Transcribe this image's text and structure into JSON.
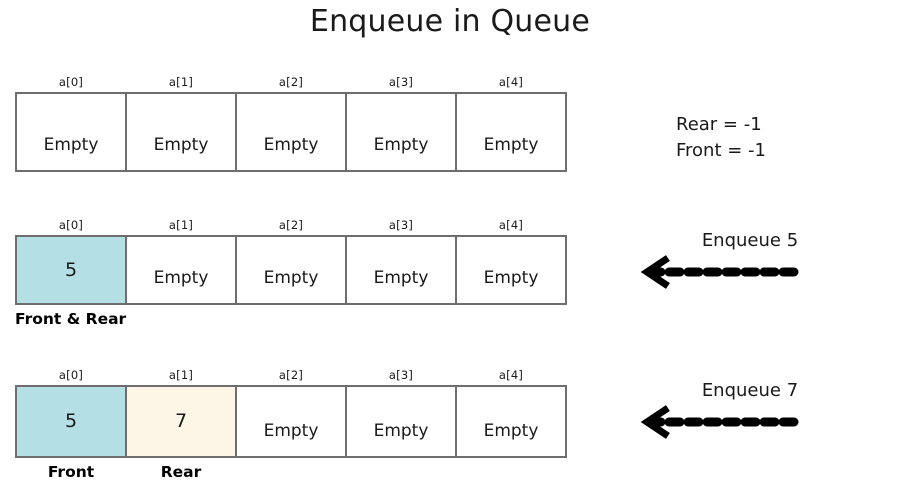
{
  "title": "Enqueue in Queue",
  "colors": {
    "front_fill": "#b3dfe5",
    "rear_fill": "#fdf5e6",
    "cell_border": "#6e6e6e",
    "text": "#1a1a1a",
    "arrow": "#000000"
  },
  "index_labels": [
    "a[0]",
    "a[1]",
    "a[2]",
    "a[3]",
    "a[4]"
  ],
  "empty_label": "Empty",
  "rows": [
    {
      "id": "initial",
      "cells": [
        {
          "value": "Empty",
          "state": "empty"
        },
        {
          "value": "Empty",
          "state": "empty"
        },
        {
          "value": "Empty",
          "state": "empty"
        },
        {
          "value": "Empty",
          "state": "empty"
        },
        {
          "value": "Empty",
          "state": "empty"
        }
      ],
      "pointers": []
    },
    {
      "id": "after-enqueue-5",
      "cells": [
        {
          "value": "5",
          "state": "front-rear"
        },
        {
          "value": "Empty",
          "state": "empty"
        },
        {
          "value": "Empty",
          "state": "empty"
        },
        {
          "value": "Empty",
          "state": "empty"
        },
        {
          "value": "Empty",
          "state": "empty"
        }
      ],
      "pointers": [
        {
          "label": "Front & Rear",
          "cell_index": 0,
          "align": "left"
        }
      ]
    },
    {
      "id": "after-enqueue-7",
      "cells": [
        {
          "value": "5",
          "state": "front"
        },
        {
          "value": "7",
          "state": "rear"
        },
        {
          "value": "Empty",
          "state": "empty"
        },
        {
          "value": "Empty",
          "state": "empty"
        },
        {
          "value": "Empty",
          "state": "empty"
        }
      ],
      "pointers": [
        {
          "label": "Front",
          "cell_index": 0,
          "align": "center"
        },
        {
          "label": "Rear",
          "cell_index": 1,
          "align": "center"
        }
      ]
    }
  ],
  "annotations": {
    "state_note": {
      "rear": "Rear = -1",
      "front": "Front = -1"
    },
    "operations": [
      {
        "label": "Enqueue 5",
        "direction": "left",
        "style": "dashed"
      },
      {
        "label": "Enqueue 7",
        "direction": "left",
        "style": "dashed"
      }
    ]
  }
}
